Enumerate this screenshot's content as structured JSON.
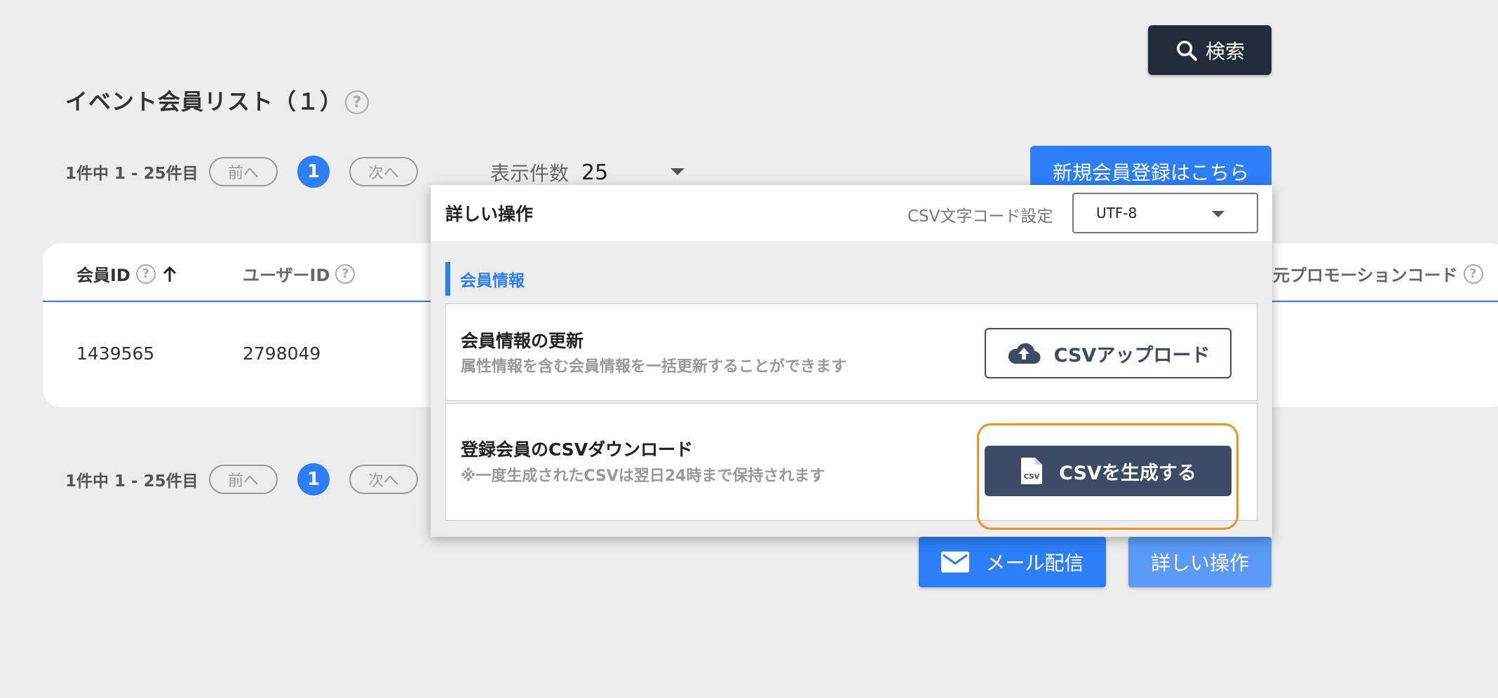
{
  "search_button": {
    "label": "検索"
  },
  "list": {
    "title": "イベント会員リスト（１）"
  },
  "pager_top": {
    "range_text": "1件中 1 - 25件目",
    "prev_label": "前へ",
    "page": "1",
    "next_label": "次へ"
  },
  "pager_bottom": {
    "range_text": "1件中 1 - 25件目",
    "prev_label": "前へ",
    "page": "1",
    "next_label": "次へ"
  },
  "per_page": {
    "label": "表示件数",
    "value": "25"
  },
  "new_member_button": {
    "label": "新規会員登録はこちら"
  },
  "table": {
    "headers": {
      "member_id": "会員ID",
      "user_id": "ユーザーID",
      "promo_code": "入元プロモーションコード"
    },
    "rows": [
      {
        "member_id": "1439565",
        "user_id": "2798049"
      }
    ]
  },
  "actions": {
    "mail_label": "メール配信",
    "detail_label": "詳しい操作"
  },
  "popup": {
    "title": "詳しい操作",
    "charset_label": "CSV文字コード設定",
    "charset_value": "UTF-8",
    "section_label": "会員情報",
    "update": {
      "title": "会員情報の更新",
      "desc": "属性情報を含む会員情報を一括更新することができます",
      "button_label": "CSVアップロード"
    },
    "download": {
      "title": "登録会員のCSVダウンロード",
      "desc": "※一度生成されたCSVは翌日24時まで保持されます",
      "button_label": "CSVを生成する",
      "file_icon_text": "CSV"
    }
  },
  "colors": {
    "primary": "#2d7ff9",
    "dark_navy": "#222b3a",
    "slate": "#3d4b66",
    "highlight": "#f0921c"
  }
}
